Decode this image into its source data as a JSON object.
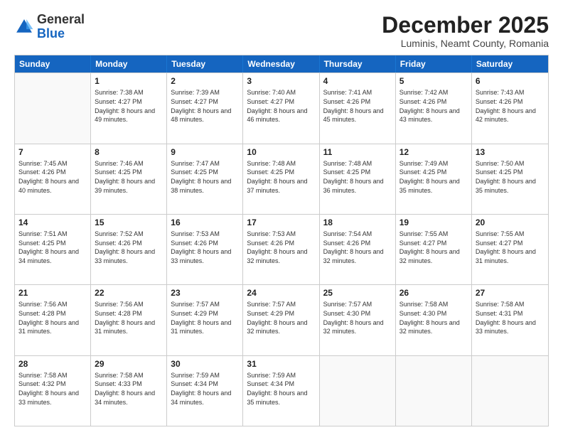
{
  "logo": {
    "general": "General",
    "blue": "Blue"
  },
  "title": "December 2025",
  "subtitle": "Luminis, Neamt County, Romania",
  "days": [
    "Sunday",
    "Monday",
    "Tuesday",
    "Wednesday",
    "Thursday",
    "Friday",
    "Saturday"
  ],
  "weeks": [
    [
      {
        "day": "",
        "sunrise": "",
        "sunset": "",
        "daylight": "",
        "empty": true
      },
      {
        "day": "1",
        "sunrise": "Sunrise: 7:38 AM",
        "sunset": "Sunset: 4:27 PM",
        "daylight": "Daylight: 8 hours and 49 minutes.",
        "empty": false
      },
      {
        "day": "2",
        "sunrise": "Sunrise: 7:39 AM",
        "sunset": "Sunset: 4:27 PM",
        "daylight": "Daylight: 8 hours and 48 minutes.",
        "empty": false
      },
      {
        "day": "3",
        "sunrise": "Sunrise: 7:40 AM",
        "sunset": "Sunset: 4:27 PM",
        "daylight": "Daylight: 8 hours and 46 minutes.",
        "empty": false
      },
      {
        "day": "4",
        "sunrise": "Sunrise: 7:41 AM",
        "sunset": "Sunset: 4:26 PM",
        "daylight": "Daylight: 8 hours and 45 minutes.",
        "empty": false
      },
      {
        "day": "5",
        "sunrise": "Sunrise: 7:42 AM",
        "sunset": "Sunset: 4:26 PM",
        "daylight": "Daylight: 8 hours and 43 minutes.",
        "empty": false
      },
      {
        "day": "6",
        "sunrise": "Sunrise: 7:43 AM",
        "sunset": "Sunset: 4:26 PM",
        "daylight": "Daylight: 8 hours and 42 minutes.",
        "empty": false
      }
    ],
    [
      {
        "day": "7",
        "sunrise": "Sunrise: 7:45 AM",
        "sunset": "Sunset: 4:26 PM",
        "daylight": "Daylight: 8 hours and 40 minutes.",
        "empty": false
      },
      {
        "day": "8",
        "sunrise": "Sunrise: 7:46 AM",
        "sunset": "Sunset: 4:25 PM",
        "daylight": "Daylight: 8 hours and 39 minutes.",
        "empty": false
      },
      {
        "day": "9",
        "sunrise": "Sunrise: 7:47 AM",
        "sunset": "Sunset: 4:25 PM",
        "daylight": "Daylight: 8 hours and 38 minutes.",
        "empty": false
      },
      {
        "day": "10",
        "sunrise": "Sunrise: 7:48 AM",
        "sunset": "Sunset: 4:25 PM",
        "daylight": "Daylight: 8 hours and 37 minutes.",
        "empty": false
      },
      {
        "day": "11",
        "sunrise": "Sunrise: 7:48 AM",
        "sunset": "Sunset: 4:25 PM",
        "daylight": "Daylight: 8 hours and 36 minutes.",
        "empty": false
      },
      {
        "day": "12",
        "sunrise": "Sunrise: 7:49 AM",
        "sunset": "Sunset: 4:25 PM",
        "daylight": "Daylight: 8 hours and 35 minutes.",
        "empty": false
      },
      {
        "day": "13",
        "sunrise": "Sunrise: 7:50 AM",
        "sunset": "Sunset: 4:25 PM",
        "daylight": "Daylight: 8 hours and 35 minutes.",
        "empty": false
      }
    ],
    [
      {
        "day": "14",
        "sunrise": "Sunrise: 7:51 AM",
        "sunset": "Sunset: 4:25 PM",
        "daylight": "Daylight: 8 hours and 34 minutes.",
        "empty": false
      },
      {
        "day": "15",
        "sunrise": "Sunrise: 7:52 AM",
        "sunset": "Sunset: 4:26 PM",
        "daylight": "Daylight: 8 hours and 33 minutes.",
        "empty": false
      },
      {
        "day": "16",
        "sunrise": "Sunrise: 7:53 AM",
        "sunset": "Sunset: 4:26 PM",
        "daylight": "Daylight: 8 hours and 33 minutes.",
        "empty": false
      },
      {
        "day": "17",
        "sunrise": "Sunrise: 7:53 AM",
        "sunset": "Sunset: 4:26 PM",
        "daylight": "Daylight: 8 hours and 32 minutes.",
        "empty": false
      },
      {
        "day": "18",
        "sunrise": "Sunrise: 7:54 AM",
        "sunset": "Sunset: 4:26 PM",
        "daylight": "Daylight: 8 hours and 32 minutes.",
        "empty": false
      },
      {
        "day": "19",
        "sunrise": "Sunrise: 7:55 AM",
        "sunset": "Sunset: 4:27 PM",
        "daylight": "Daylight: 8 hours and 32 minutes.",
        "empty": false
      },
      {
        "day": "20",
        "sunrise": "Sunrise: 7:55 AM",
        "sunset": "Sunset: 4:27 PM",
        "daylight": "Daylight: 8 hours and 31 minutes.",
        "empty": false
      }
    ],
    [
      {
        "day": "21",
        "sunrise": "Sunrise: 7:56 AM",
        "sunset": "Sunset: 4:28 PM",
        "daylight": "Daylight: 8 hours and 31 minutes.",
        "empty": false
      },
      {
        "day": "22",
        "sunrise": "Sunrise: 7:56 AM",
        "sunset": "Sunset: 4:28 PM",
        "daylight": "Daylight: 8 hours and 31 minutes.",
        "empty": false
      },
      {
        "day": "23",
        "sunrise": "Sunrise: 7:57 AM",
        "sunset": "Sunset: 4:29 PM",
        "daylight": "Daylight: 8 hours and 31 minutes.",
        "empty": false
      },
      {
        "day": "24",
        "sunrise": "Sunrise: 7:57 AM",
        "sunset": "Sunset: 4:29 PM",
        "daylight": "Daylight: 8 hours and 32 minutes.",
        "empty": false
      },
      {
        "day": "25",
        "sunrise": "Sunrise: 7:57 AM",
        "sunset": "Sunset: 4:30 PM",
        "daylight": "Daylight: 8 hours and 32 minutes.",
        "empty": false
      },
      {
        "day": "26",
        "sunrise": "Sunrise: 7:58 AM",
        "sunset": "Sunset: 4:30 PM",
        "daylight": "Daylight: 8 hours and 32 minutes.",
        "empty": false
      },
      {
        "day": "27",
        "sunrise": "Sunrise: 7:58 AM",
        "sunset": "Sunset: 4:31 PM",
        "daylight": "Daylight: 8 hours and 33 minutes.",
        "empty": false
      }
    ],
    [
      {
        "day": "28",
        "sunrise": "Sunrise: 7:58 AM",
        "sunset": "Sunset: 4:32 PM",
        "daylight": "Daylight: 8 hours and 33 minutes.",
        "empty": false
      },
      {
        "day": "29",
        "sunrise": "Sunrise: 7:58 AM",
        "sunset": "Sunset: 4:33 PM",
        "daylight": "Daylight: 8 hours and 34 minutes.",
        "empty": false
      },
      {
        "day": "30",
        "sunrise": "Sunrise: 7:59 AM",
        "sunset": "Sunset: 4:34 PM",
        "daylight": "Daylight: 8 hours and 34 minutes.",
        "empty": false
      },
      {
        "day": "31",
        "sunrise": "Sunrise: 7:59 AM",
        "sunset": "Sunset: 4:34 PM",
        "daylight": "Daylight: 8 hours and 35 minutes.",
        "empty": false
      },
      {
        "day": "",
        "sunrise": "",
        "sunset": "",
        "daylight": "",
        "empty": true
      },
      {
        "day": "",
        "sunrise": "",
        "sunset": "",
        "daylight": "",
        "empty": true
      },
      {
        "day": "",
        "sunrise": "",
        "sunset": "",
        "daylight": "",
        "empty": true
      }
    ]
  ]
}
